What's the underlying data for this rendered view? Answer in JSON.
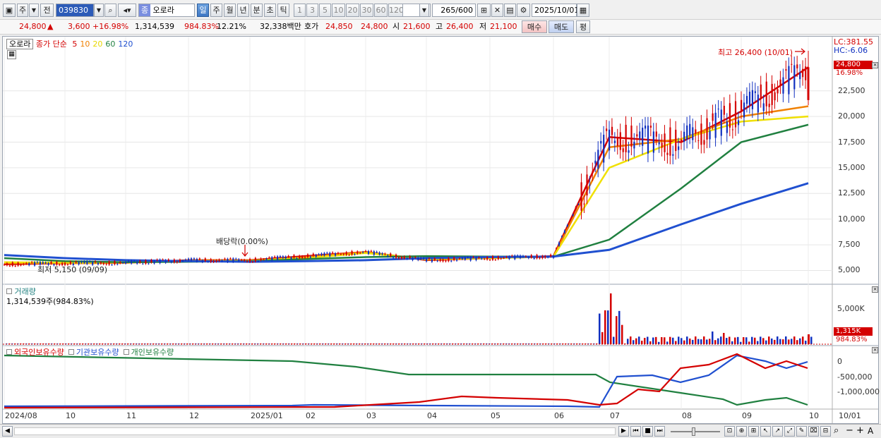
{
  "toolbar": {
    "market_type": "주",
    "prev_label": "전",
    "code": "039830",
    "stock_badge": "종",
    "stock_name": "오로라",
    "periods": [
      {
        "label": "일",
        "selected": true
      },
      {
        "label": "주",
        "selected": false
      },
      {
        "label": "월",
        "selected": false
      },
      {
        "label": "년",
        "selected": false
      },
      {
        "label": "분",
        "selected": false
      },
      {
        "label": "초",
        "selected": false
      },
      {
        "label": "틱",
        "selected": false
      }
    ],
    "intervals": [
      "1",
      "3",
      "5",
      "10",
      "20",
      "30",
      "60",
      "120"
    ],
    "count": "265",
    "count_max": "/600",
    "date": "2025/10/01"
  },
  "quote": {
    "price": "24,800",
    "arrow": "▲",
    "change": "3,600",
    "change_pct": "+16.98%",
    "volume": "1,314,539",
    "volume_ratio": "984.83%",
    "turnover": "12.21%",
    "amount": "32,338백만",
    "bid_label": "호가",
    "ask_price": "24,850",
    "bid_price": "24,800",
    "open_label": "시",
    "open": "21,600",
    "high_label": "고",
    "high": "26,400",
    "low_label": "저",
    "low": "21,100",
    "buy_label": "매수",
    "sell_label": "매도",
    "avg_label": "평"
  },
  "price_pane": {
    "stock_label": "오로라",
    "legend_prefix": "종가 단순",
    "ma_labels": [
      {
        "label": "5",
        "color": "#d40000"
      },
      {
        "label": "10",
        "color": "#f08000"
      },
      {
        "label": "20",
        "color": "#e8d800"
      },
      {
        "label": "60",
        "color": "#208040"
      },
      {
        "label": "120",
        "color": "#2050d0"
      }
    ],
    "lc": "LC:381.55",
    "hc": "HC:-6.06",
    "current_tag": "24,800",
    "current_pct": "16.98%",
    "high_annotation": "최고 26,400 (10/01)",
    "low_annotation": "최저 5,150 (09/09)",
    "dividend_annotation": "배당락(0.00%)",
    "y_ticks": [
      "22,500",
      "20,000",
      "17,500",
      "15,000",
      "12,500",
      "10,000",
      "7,500",
      "5,000"
    ]
  },
  "volume_pane": {
    "title": "거래량",
    "value": "1,314,539주(984.83%)",
    "y_tick": "5,000K",
    "current_tag": "1,315K",
    "current_pct": "984.83%"
  },
  "holdings_pane": {
    "legend": [
      {
        "label": "외국인보유수량",
        "color": "#d40000"
      },
      {
        "label": "기관보유수량",
        "color": "#2050d0"
      },
      {
        "label": "개인보유수량",
        "color": "#208040"
      }
    ],
    "y_ticks": [
      "0",
      "-500,000",
      "-1,000,000"
    ]
  },
  "x_axis": [
    "2024/08",
    "10",
    "11",
    "12",
    "2025/01",
    "02",
    "03",
    "04",
    "05",
    "06",
    "07",
    "08",
    "09",
    "10",
    "10/01"
  ],
  "colors": {
    "ma5": "#d40000",
    "ma10": "#f08000",
    "ma20": "#f0e000",
    "ma60": "#208040",
    "ma120": "#2050d0",
    "up": "#d40000",
    "down": "#1030c0"
  },
  "chart_data": {
    "type": "line",
    "x": [
      "2024/08",
      "10",
      "11",
      "12",
      "2025/01",
      "02",
      "03",
      "04",
      "05",
      "06",
      "07",
      "08",
      "09",
      "10"
    ],
    "series": [
      {
        "name": "5",
        "values": [
          5600,
          5700,
          5750,
          6000,
          6000,
          6400,
          6800,
          6000,
          6200,
          6400,
          18000,
          17500,
          20500,
          24800
        ]
      },
      {
        "name": "10",
        "values": [
          5700,
          5700,
          5750,
          5950,
          5950,
          6300,
          6800,
          6050,
          6200,
          6350,
          17000,
          17800,
          20000,
          21000
        ]
      },
      {
        "name": "20",
        "values": [
          5800,
          5750,
          5800,
          5950,
          5950,
          6200,
          6700,
          6100,
          6200,
          6350,
          15000,
          17800,
          19500,
          20000
        ]
      },
      {
        "name": "60",
        "values": [
          6200,
          5900,
          5800,
          5850,
          5900,
          6100,
          6300,
          6400,
          6350,
          6350,
          8000,
          13000,
          17500,
          19200
        ]
      },
      {
        "name": "120",
        "values": [
          6500,
          6200,
          6000,
          5900,
          5850,
          5900,
          6000,
          6200,
          6300,
          6350,
          7000,
          9500,
          11500,
          13500
        ]
      }
    ],
    "ylim": [
      4000,
      27500
    ]
  }
}
